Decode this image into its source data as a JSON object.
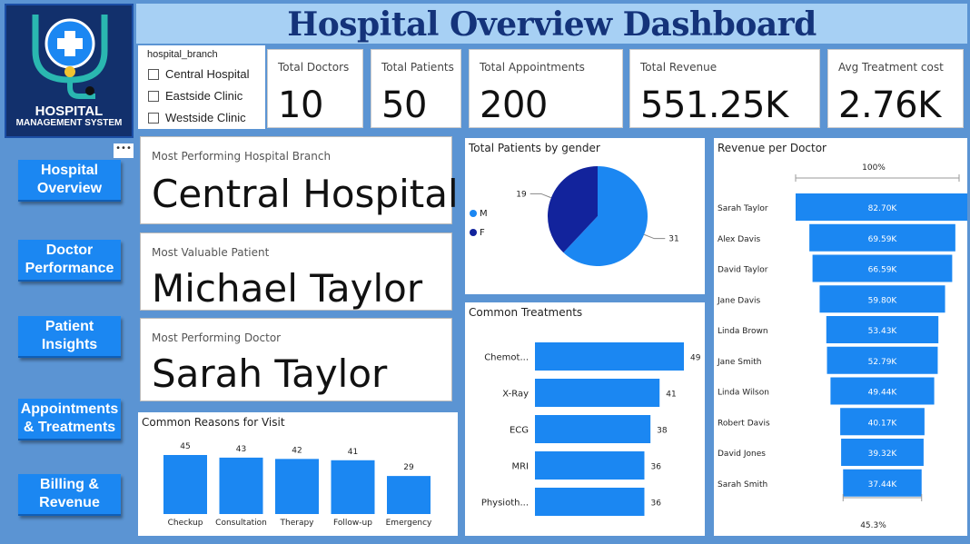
{
  "header": {
    "title": "Hospital Overview Dashboard"
  },
  "logo": {
    "line1": "HOSPITAL",
    "line2": "MANAGEMENT SYSTEM"
  },
  "nav": [
    {
      "label": "Hospital Overview"
    },
    {
      "label": "Doctor Performance"
    },
    {
      "label": "Patient Insights"
    },
    {
      "label": "Appointments & Treatments"
    },
    {
      "label": "Billing & Revenue"
    }
  ],
  "more_options": "•••",
  "slicer": {
    "title": "hospital_branch",
    "options": [
      "Central Hospital",
      "Eastside Clinic",
      "Westside Clinic"
    ]
  },
  "kpis": [
    {
      "label": "Total Doctors",
      "value": "10"
    },
    {
      "label": "Total Patients",
      "value": "50"
    },
    {
      "label": "Total Appointments",
      "value": "200"
    },
    {
      "label": "Total Revenue",
      "value": "551.25K"
    },
    {
      "label": "Avg Treatment cost",
      "value": "2.76K"
    }
  ],
  "highlights": [
    {
      "label": "Most Performing Hospital Branch",
      "value": "Central Hospital"
    },
    {
      "label": "Most Valuable Patient",
      "value": "Michael Taylor"
    },
    {
      "label": "Most Performing Doctor",
      "value": "Sarah Taylor"
    }
  ],
  "colors": {
    "accent": "#1b87f2",
    "dark": "#12239c",
    "header_bg": "#a7d0f4",
    "title": "#14337a"
  },
  "chart_data": [
    {
      "type": "bar",
      "title": "Common Reasons for Visit",
      "categories": [
        "Checkup",
        "Consultation",
        "Therapy",
        "Follow-up",
        "Emergency"
      ],
      "values": [
        45,
        43,
        42,
        41,
        29
      ]
    },
    {
      "type": "pie",
      "title": "Total Patients by gender",
      "legend": [
        "M",
        "F"
      ],
      "values": [
        31,
        19
      ],
      "colors": [
        "#1b87f2",
        "#12239c"
      ]
    },
    {
      "type": "bar",
      "orientation": "horizontal",
      "title": "Common Treatments",
      "categories": [
        "Chemot...",
        "X-Ray",
        "ECG",
        "MRI",
        "Physioth..."
      ],
      "values": [
        49,
        41,
        38,
        36,
        36
      ]
    },
    {
      "type": "bar",
      "orientation": "funnel",
      "title": "Revenue per Doctor",
      "top_label": "100%",
      "bottom_label": "45.3%",
      "categories": [
        "Sarah Taylor",
        "Alex Davis",
        "David Taylor",
        "Jane Davis",
        "Linda Brown",
        "Jane Smith",
        "Linda Wilson",
        "Robert Davis",
        "David Jones",
        "Sarah Smith"
      ],
      "values": [
        82.7,
        69.59,
        66.59,
        59.8,
        53.43,
        52.79,
        49.44,
        40.17,
        39.32,
        37.44
      ],
      "value_labels": [
        "82.70K",
        "69.59K",
        "66.59K",
        "59.80K",
        "53.43K",
        "52.79K",
        "49.44K",
        "40.17K",
        "39.32K",
        "37.44K"
      ]
    }
  ]
}
